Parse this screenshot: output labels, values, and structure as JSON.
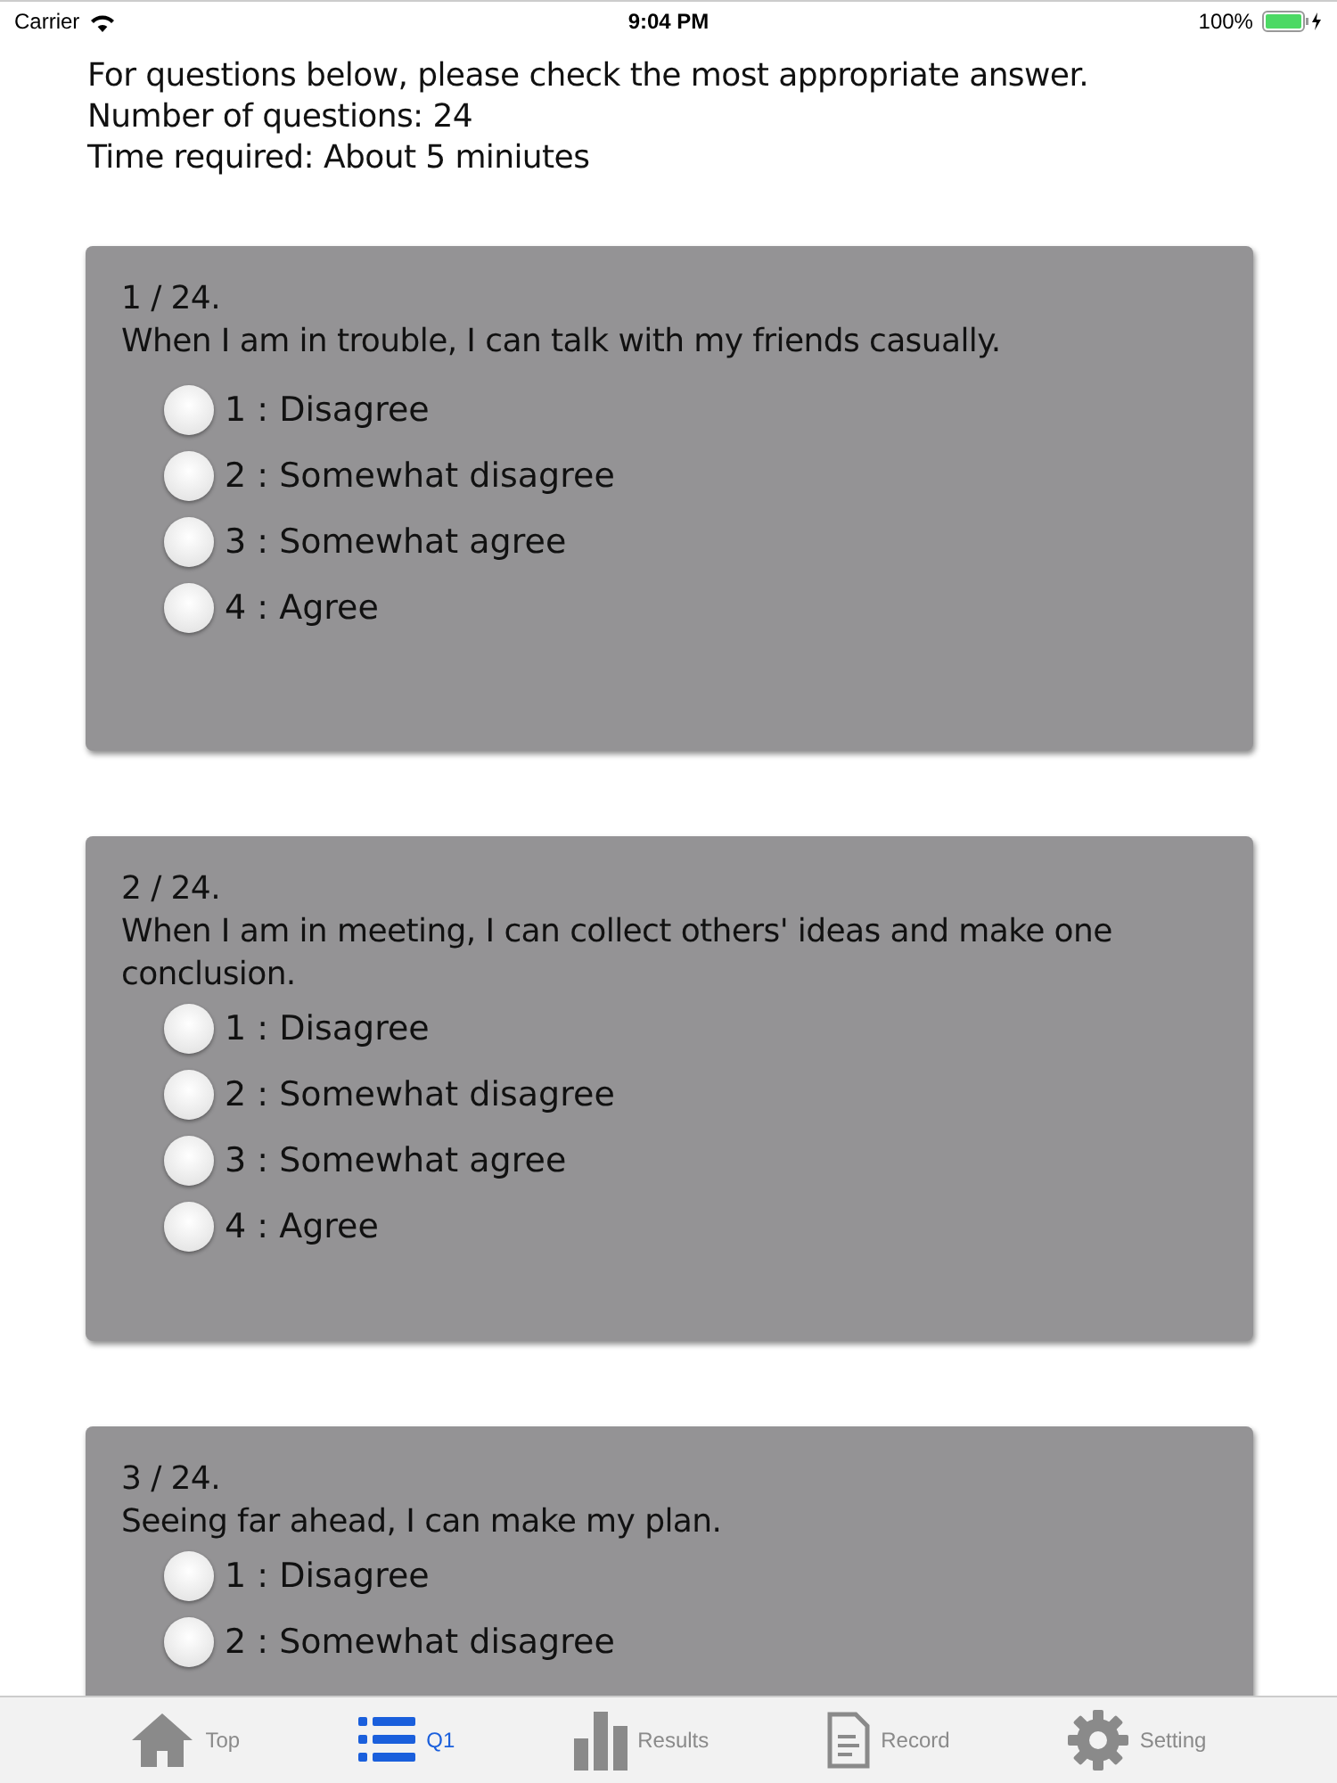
{
  "status_bar": {
    "carrier": "Carrier",
    "time": "9:04 PM",
    "battery": "100%"
  },
  "intro": [
    "For questions below, please check the most appropriate answer.",
    "Number of questions: 24",
    "Time required: About 5 miniutes"
  ],
  "questions": [
    {
      "number": "1 / 24.",
      "text": "When I am in trouble, I can talk with my friends casually.",
      "options": [
        {
          "label": "1 : Disagree",
          "selected": false
        },
        {
          "label": "2 : Somewhat disagree",
          "selected": false
        },
        {
          "label": "3 : Somewhat agree",
          "selected": false
        },
        {
          "label": "4 : Agree",
          "selected": false
        }
      ]
    },
    {
      "number": "2 / 24.",
      "text": "When I am in meeting, I can collect others' ideas and make one conclusion.",
      "options": [
        {
          "label": "1 : Disagree",
          "selected": false
        },
        {
          "label": "2 : Somewhat disagree",
          "selected": false
        },
        {
          "label": "3 : Somewhat agree",
          "selected": false
        },
        {
          "label": "4 : Agree",
          "selected": false
        }
      ]
    },
    {
      "number": "3 / 24.",
      "text": "Seeing far ahead, I can make my plan.",
      "options": [
        {
          "label": "1 : Disagree",
          "selected": false
        },
        {
          "label": "2 : Somewhat disagree",
          "selected": false
        }
      ]
    }
  ],
  "tabs": [
    {
      "kind": "home",
      "label": "Top",
      "selected": false
    },
    {
      "kind": "list",
      "label": "Q1",
      "selected": true
    },
    {
      "kind": "chart",
      "label": "Results",
      "selected": false
    },
    {
      "kind": "document",
      "label": "Record",
      "selected": false
    },
    {
      "kind": "gear",
      "label": "Setting",
      "selected": false
    }
  ]
}
